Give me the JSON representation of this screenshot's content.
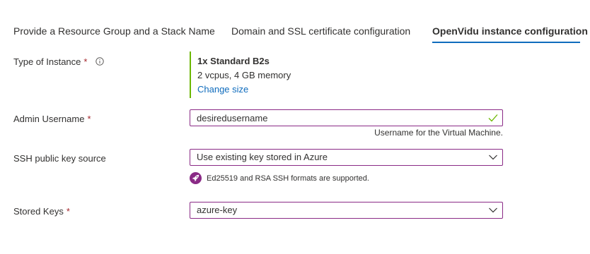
{
  "tabs": [
    {
      "label": "Provide a Resource Group and a Stack Name",
      "active": false
    },
    {
      "label": "Domain and SSL certificate configuration",
      "active": false
    },
    {
      "label": "OpenVidu instance configuration",
      "active": true
    }
  ],
  "instance_type": {
    "label": "Type of Instance",
    "required_mark": "*",
    "info_icon": "info-icon",
    "size_name": "1x Standard B2s",
    "size_specs": "2 vcpus, 4 GB memory",
    "change_link": "Change size"
  },
  "admin_username": {
    "label": "Admin Username",
    "required_mark": "*",
    "value": "desiredusername",
    "valid_icon": "check-icon",
    "helper": "Username for the Virtual Machine."
  },
  "ssh_source": {
    "label": "SSH public key source",
    "selected": "Use existing key stored in Azure",
    "note_icon": "rocket-icon",
    "note": "Ed25519 and RSA SSH formats are supported."
  },
  "stored_keys": {
    "label": "Stored Keys",
    "required_mark": "*",
    "selected": "azure-key"
  },
  "colors": {
    "accent": "#8a2a86",
    "link": "#0f6cbd",
    "success": "#6bb700",
    "required": "#a4262c"
  }
}
